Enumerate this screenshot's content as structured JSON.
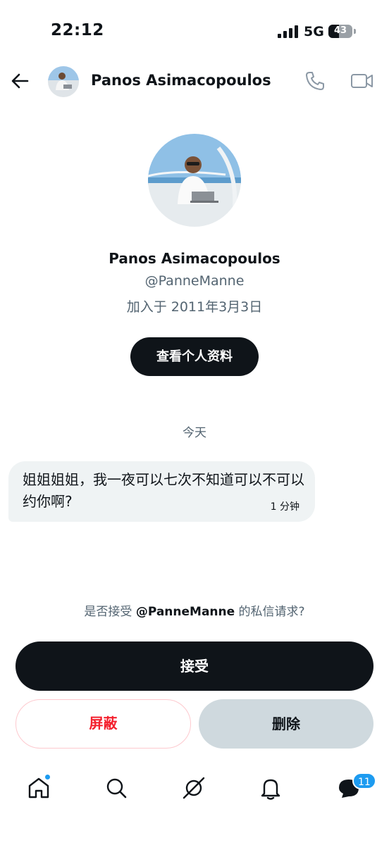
{
  "status_bar": {
    "time": "22:12",
    "network": "5G",
    "battery": "43",
    "battery_level": 0.43
  },
  "header": {
    "name": "Panos Asimacopoulos"
  },
  "profile": {
    "name": "Panos Asimacopoulos",
    "handle": "@PanneManne",
    "joined": "加入于 2011年3月3日",
    "view_profile_label": "查看个人资料"
  },
  "conversation": {
    "date_separator": "今天",
    "messages": [
      {
        "text": "姐姐姐姐，我一夜可以七次不知道可以不可以约你啊?",
        "time": "1 分钟"
      }
    ]
  },
  "request": {
    "prompt_prefix": "是否接受 ",
    "prompt_handle": "@PanneManne",
    "prompt_suffix": " 的私信请求?",
    "accept_label": "接受",
    "block_label": "屏蔽",
    "delete_label": "删除"
  },
  "tab_bar": {
    "items": [
      "home-icon",
      "search-icon",
      "grok-icon",
      "bell-icon",
      "messages-icon"
    ],
    "messages_badge": "11"
  },
  "colors": {
    "primary": "#0f1419",
    "secondary_text": "#536471",
    "accent_blue": "#1d9bf0",
    "danger_red": "#f4212e",
    "bubble_bg": "#eff3f4",
    "delete_bg": "#cfd9de"
  }
}
